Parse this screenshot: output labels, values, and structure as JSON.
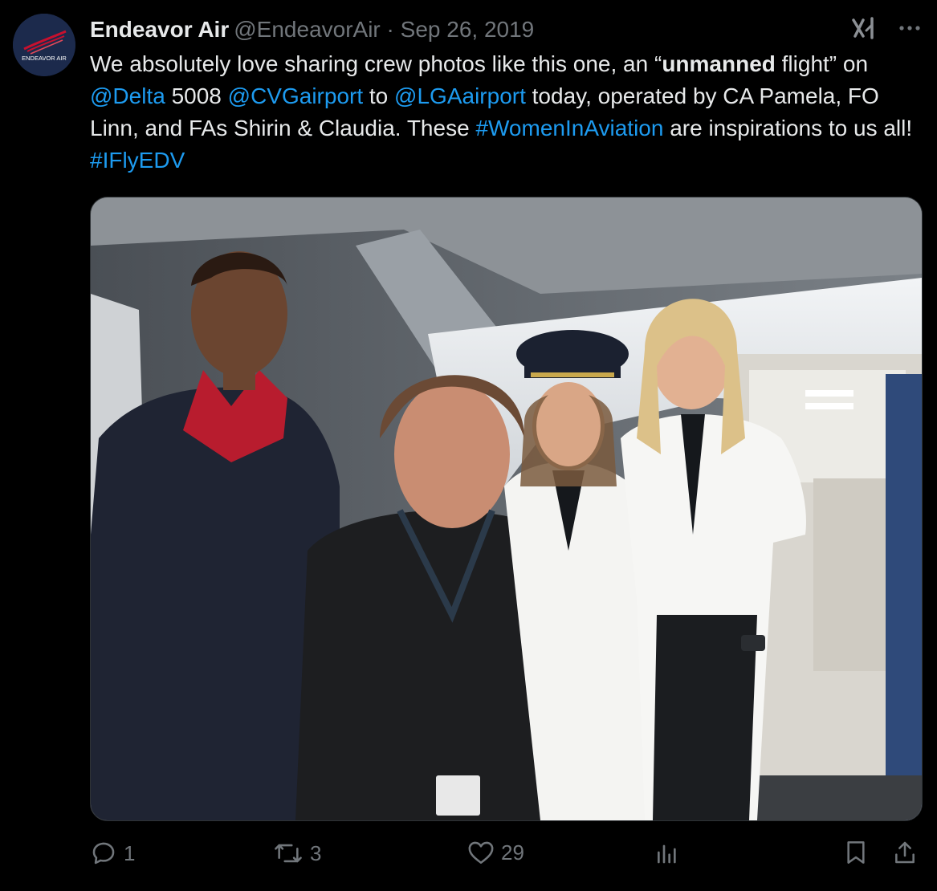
{
  "author": {
    "name": "Endeavor Air",
    "handle": "@EndeavorAir",
    "date": "Sep 26, 2019",
    "avatar_logo_text": "ENDEAVOR AIR"
  },
  "tweet": {
    "seg1": "We absolutely love sharing crew photos like this one, an “",
    "bold": "unmanned",
    "seg2": " flight” on ",
    "mention_delta": "@Delta",
    "seg3": " 5008 ",
    "mention_cvg": "@CVGairport",
    "seg4": "  to ",
    "mention_lga": "@LGAairport",
    "seg5": " today, operated by CA Pamela, FO Linn, and FAs Shirin & Claudia. These ",
    "hashtag_women": "#WomenInAviation",
    "seg6": " are inspirations to us all! ",
    "hashtag_ifly": "#IFlyEDV"
  },
  "metrics": {
    "replies": "1",
    "retweets": "3",
    "likes": "29"
  },
  "icons": {
    "reply": "reply-icon",
    "retweet": "retweet-icon",
    "like": "heart-icon",
    "views": "views-icon",
    "bookmark": "bookmark-icon",
    "share": "share-icon",
    "grok": "grok-icon",
    "more": "more-icon"
  },
  "colors": {
    "background": "#000000",
    "text": "#e7e9ea",
    "secondary": "#71767b",
    "link": "#1d9bf0",
    "border": "#2f3336"
  }
}
